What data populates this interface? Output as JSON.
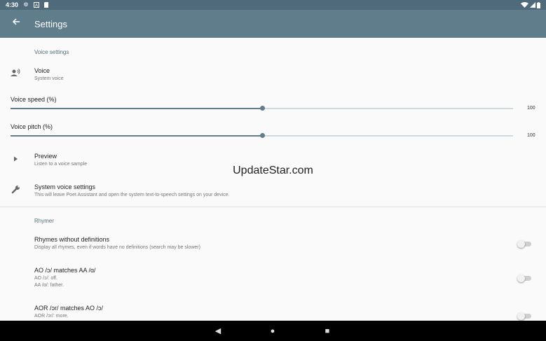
{
  "status_bar": {
    "time": "4:30"
  },
  "app_bar": {
    "title": "Settings"
  },
  "voice_settings": {
    "category": "Voice settings",
    "voice": {
      "title": "Voice",
      "summary": "System voice"
    },
    "speed": {
      "label": "Voice speed (%)",
      "value": "100",
      "fraction": 0.5
    },
    "pitch": {
      "label": "Voice pitch (%)",
      "value": "100",
      "fraction": 0.5
    },
    "preview": {
      "title": "Preview",
      "summary": "Listen to a voice sample"
    },
    "system_voice": {
      "title": "System voice settings",
      "summary": "This will leave Poet Assistant and open the system text-to-speech settings on your device."
    }
  },
  "rhymer": {
    "category": "Rhymer",
    "items": [
      {
        "title": "Rhymes without definitions",
        "summary": "Display all rhymes, even if words have no definitions (search may be slower)",
        "enabled": false
      },
      {
        "title": "AO /ɔ/ matches AA /ɑ/",
        "summary1": "AO /ɔ/: off.",
        "summary2": "AA /ɑ/: father.",
        "enabled": false
      },
      {
        "title": "AOR /ɔr/ matches AO /ɔ/",
        "summary1": "AOR /ɔr/: more.",
        "enabled": false
      }
    ]
  },
  "watermark": "UpdateStar.com",
  "nav": {
    "back": "◀",
    "home": "●",
    "recents": "■"
  },
  "colors": {
    "app_bar": "#607d8b",
    "status_bar": "#4f6b7b",
    "accent": "#607d8b"
  }
}
